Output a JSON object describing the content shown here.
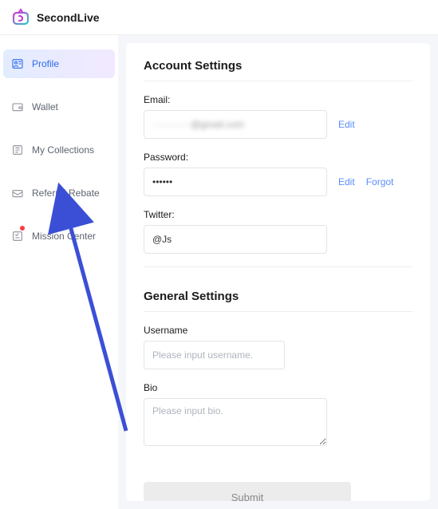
{
  "brand": "SecondLive",
  "sidebar": {
    "items": [
      {
        "label": "Profile"
      },
      {
        "label": "Wallet"
      },
      {
        "label": "My Collections"
      },
      {
        "label": "Referral Rebate"
      },
      {
        "label": "Mission Center"
      }
    ]
  },
  "account": {
    "title": "Account Settings",
    "email_label": "Email:",
    "email_value": "············@gmail.com",
    "email_edit": "Edit",
    "password_label": "Password:",
    "password_value": "••••••",
    "password_edit": "Edit",
    "password_forgot": "Forgot",
    "twitter_label": "Twitter:",
    "twitter_value": "@Js"
  },
  "general": {
    "title": "General Settings",
    "username_label": "Username",
    "username_placeholder": "Please input username.",
    "bio_label": "Bio",
    "bio_placeholder": "Please input bio.",
    "submit": "Submit"
  }
}
